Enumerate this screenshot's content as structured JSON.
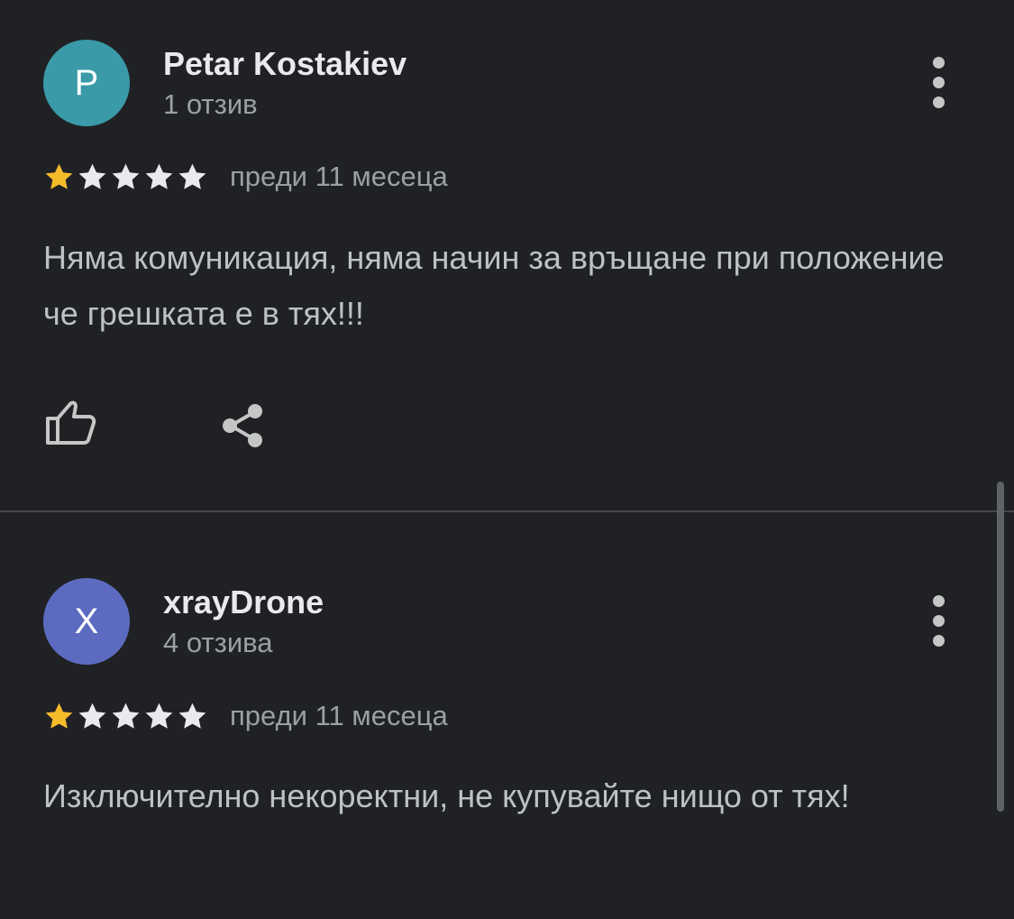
{
  "colors": {
    "background": "#202124",
    "star_filled": "#f6bb2b",
    "star_empty": "#e8eaed",
    "avatar_review_1": "#3a9aa8",
    "avatar_review_2": "#5c6bc0",
    "divider": "#46484d"
  },
  "reviews": [
    {
      "avatar_letter": "P",
      "author": "Petar Kostakiev",
      "review_count": "1 отзив",
      "rating": 1,
      "rating_max": 5,
      "date": "преди 11 месеца",
      "text": "Няма комуникация, няма начин за връщане при положение че грешката е в тях!!!",
      "actions": [
        "thumbs-up-icon",
        "share-icon"
      ],
      "menu_icon": "more-vert-icon"
    },
    {
      "avatar_letter": "X",
      "author": "xrayDrone",
      "review_count": "4 отзива",
      "rating": 1,
      "rating_max": 5,
      "date": "преди 11 месеца",
      "text": "Изключително некоректни, не купувайте нищо от тях!",
      "menu_icon": "more-vert-icon"
    }
  ]
}
